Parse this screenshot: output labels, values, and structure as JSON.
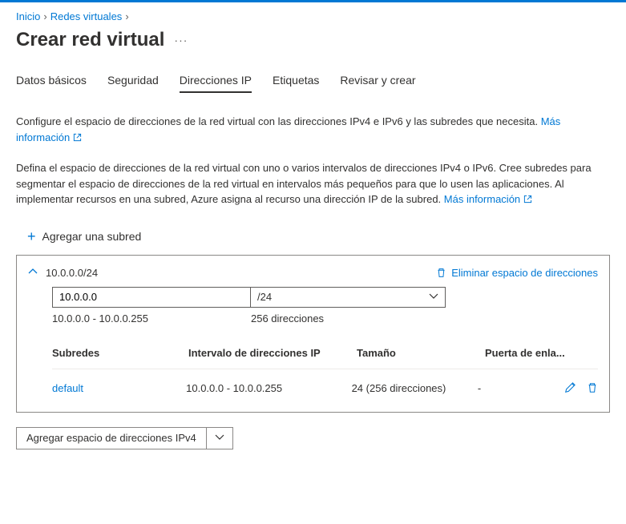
{
  "breadcrumb": {
    "home": "Inicio",
    "vnets": "Redes virtuales"
  },
  "page_title": "Crear red virtual",
  "tabs": {
    "basics": "Datos básicos",
    "security": "Seguridad",
    "ip": "Direcciones IP",
    "tags": "Etiquetas",
    "review": "Revisar y crear"
  },
  "descriptions": {
    "d1_text": "Configure el espacio de direcciones de la red virtual con las direcciones IPv4 e IPv6 y las subredes que necesita. ",
    "d1_link": "Más información",
    "d2_text": "Defina el espacio de direcciones de la red virtual con uno o varios intervalos de direcciones IPv4 o IPv6. Cree subredes para segmentar el espacio de direcciones de la red virtual en intervalos más pequeños para que lo usen las aplicaciones. Al implementar recursos en una subred, Azure asigna al recurso una dirección IP de la subred. ",
    "d2_link": "Más información"
  },
  "add_subnet_label": "Agregar una subred",
  "panel": {
    "cidr_title": "10.0.0.0/24",
    "delete_space_label": "Eliminar espacio de direcciones",
    "ip_value": "10.0.0.0",
    "cidr_select": "/24",
    "range_help": "10.0.0.0 - 10.0.0.255",
    "count_help": "256 direcciones"
  },
  "table": {
    "headers": {
      "subnets": "Subredes",
      "range": "Intervalo de direcciones IP",
      "size": "Tamaño",
      "gateway": "Puerta de enla..."
    },
    "row": {
      "name": "default",
      "range": "10.0.0.0 - 10.0.0.255",
      "size": "24 (256 direcciones)",
      "gateway": "-"
    }
  },
  "bottom_dropdown_label": "Agregar espacio de direcciones IPv4"
}
